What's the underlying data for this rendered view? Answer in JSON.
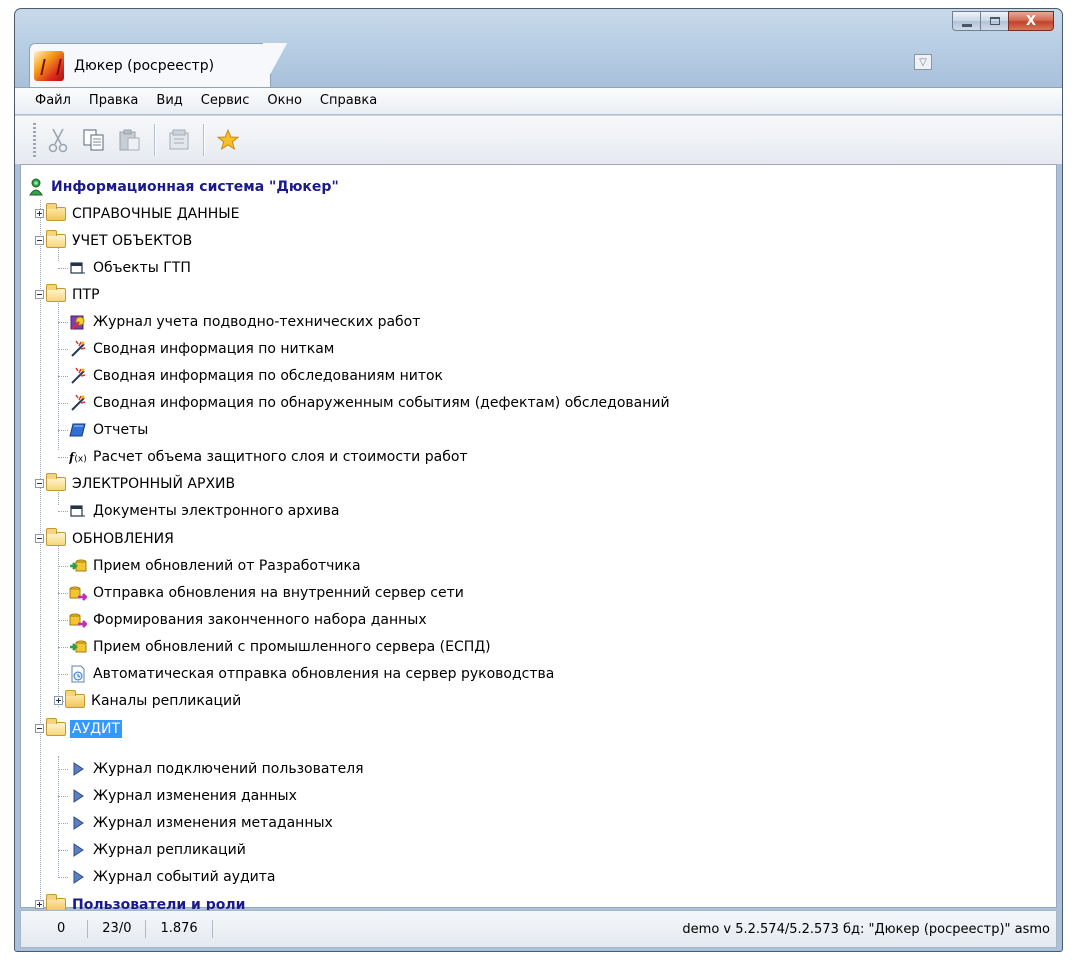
{
  "window": {
    "controls": {
      "close_glyph": "X"
    }
  },
  "tab": {
    "title": "Дюкер (росреестр)",
    "icon": "duker-logo-icon"
  },
  "menu": [
    "Файл",
    "Правка",
    "Вид",
    "Сервис",
    "Окно",
    "Справка"
  ],
  "toolbar": {
    "buttons": [
      "cut-icon",
      "copy-icon",
      "paste-icon",
      "properties-icon",
      "favorites-star-icon"
    ]
  },
  "tree": {
    "root": "Информационная система \"Дюкер\"",
    "reference_data": "СПРАВОЧНЫЕ ДАННЫЕ",
    "objects": {
      "label": "УЧЕТ ОБЪЕКТОВ",
      "items": [
        "Объекты ГТП"
      ]
    },
    "ptr": {
      "label": "ПТР",
      "items": [
        "Журнал учета подводно-технических работ",
        "Сводная информация по ниткам",
        "Сводная информация по обследованиям ниток",
        "Сводная информация по обнаруженным событиям (дефектам) обследований",
        "Отчеты",
        "Расчет объема защитного слоя  и стоимости работ"
      ]
    },
    "archive": {
      "label": "ЭЛЕКТРОННЫЙ  АРХИВ",
      "items": [
        "Документы электронного архива"
      ]
    },
    "updates": {
      "label": "ОБНОВЛЕНИЯ",
      "items": [
        "Прием обновлений от Разработчика",
        "Отправка обновления на внутренний сервер сети",
        "Формирования законченного набора данных",
        "Прием обновлений с промышленного сервера (ЕСПД)",
        "Автоматическая отправка обновления на сервер руководства",
        "Каналы репликаций"
      ]
    },
    "audit": {
      "label": "АУДИТ",
      "items": [
        "Журнал подключений пользователя",
        "Журнал изменения данных",
        "Журнал изменения метаданных",
        "Журнал репликаций",
        "Журнал событий аудита"
      ]
    },
    "users": "Пользователи и роли"
  },
  "status": {
    "cell1": "0",
    "cell2": "23/0",
    "cell3": "1.876",
    "right": "demo  v 5.2.574/5.2.573  бд: \"Дюкер (росреестр)\" asmo"
  },
  "colors": {
    "selection": "#3399ff",
    "root_text": "#1a1a8c",
    "folder": "#f0c65a"
  }
}
